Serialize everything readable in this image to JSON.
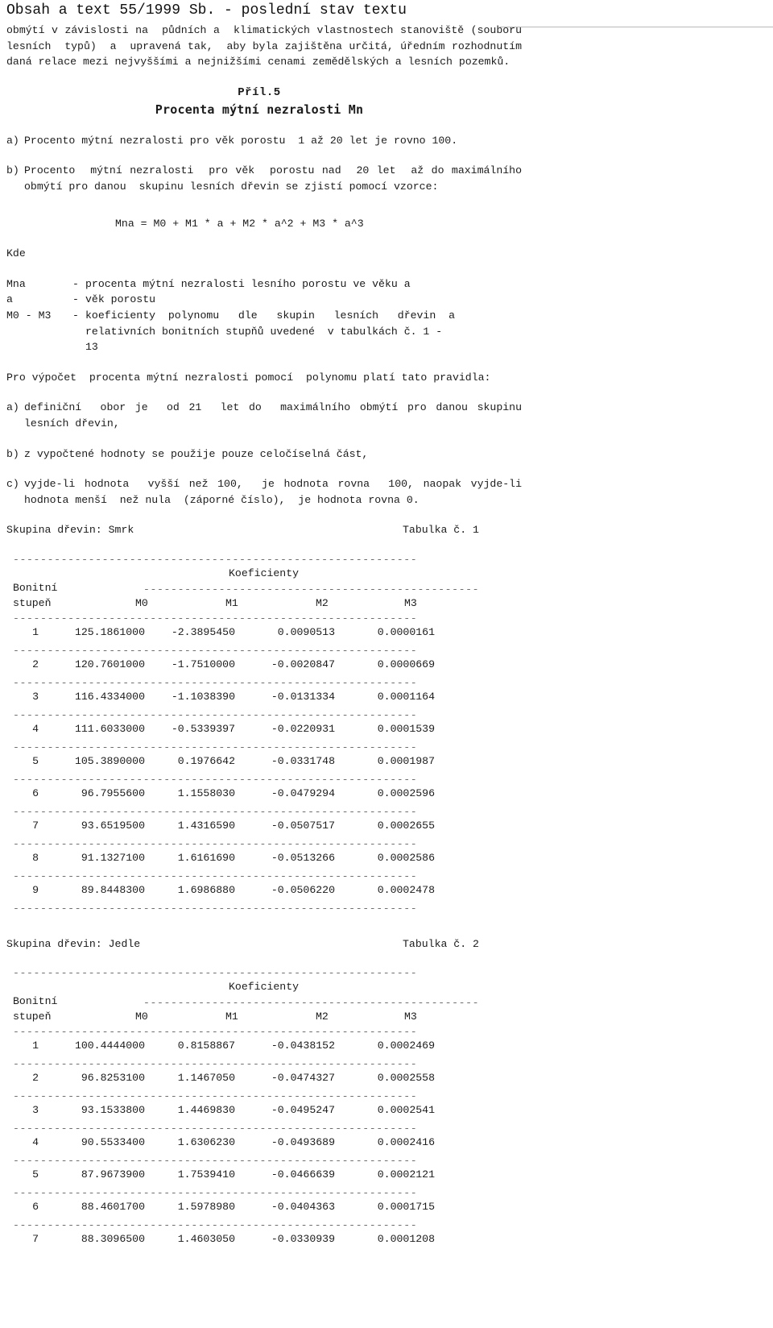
{
  "header": {
    "title": "Obsah a text 55/1999 Sb. - poslední stav textu"
  },
  "intro": {
    "paragraph": "obmýtí v závislosti na  půdních a  klimatických vlastnostech stanoviště (souboru  lesních  typů)  a  upravená tak,  aby byla zajištěna určitá, úředním rozhodnutím  daná relace mezi nejvyššími a nejnižšími cenami zemědělských a lesních pozemků."
  },
  "appendix": {
    "number_label": "Příl.5",
    "title": "Procenta mýtní nezralosti Mn"
  },
  "rules_top": [
    {
      "marker": "a)",
      "text": "Procento mýtní nezralosti pro věk porostu  1 až 20 let je rovno 100."
    },
    {
      "marker": "b)",
      "text": "Procento  mýtní nezralosti  pro věk  porostu nad  20 let  až do maximálního  obmýtí pro danou  skupinu lesních dřevin se zjistí pomocí vzorce:"
    }
  ],
  "formula": "Mna = M0 + M1 * a + M2 * a^2 + M3 * a^3",
  "where": {
    "label": "Kde",
    "definitions": [
      {
        "term": "Mna",
        "dash": "-",
        "desc": "procenta mýtní nezralosti lesního porostu ve věku a"
      },
      {
        "term": "a",
        "dash": "-",
        "desc": "věk porostu"
      },
      {
        "term": "M0 - M3",
        "dash": "-",
        "desc": "koeficienty  polynomu   dle   skupin   lesních   dřevin  a"
      }
    ],
    "cont_line_1": "relativních bonitních stupňů uvedené  v tabulkách č. 1 -",
    "cont_line_2": "13"
  },
  "calc_intro": "Pro výpočet  procenta mýtní nezralosti pomocí  polynomu platí tato pravidla:",
  "rules_calc": [
    {
      "marker": "a)",
      "text": "definiční  obor je  od 21  let do  maximálního obmýtí pro danou skupinu lesních dřevin,"
    },
    {
      "marker": "b)",
      "text": "z vypočtené hodnoty se použije pouze celočíselná část,"
    },
    {
      "marker": "c)",
      "text": "vyjde-li hodnota  vyšší než 100,  je hodnota rovna  100, naopak vyjde-li  hodnota menší  než nula  (záporné číslo),  je hodnota rovna 0."
    }
  ],
  "table_common": {
    "koeficienty_label": "Koeficienty",
    "bonitni_label": "Bonitní",
    "stupen_label": "stupeň",
    "columns": [
      "M0",
      "M1",
      "M2",
      "M3"
    ],
    "full_rule": "-----------------------------------------------------------",
    "short_rule": "-------------------------------------------------"
  },
  "tables": [
    {
      "group_label": "Skupina dřevin: Smrk",
      "table_label": "Tabulka č. 1",
      "rows": [
        {
          "stupen": "1",
          "m0": "125.1861000",
          "m1": "-2.3895450",
          "m2": "0.0090513",
          "m3": "0.0000161"
        },
        {
          "stupen": "2",
          "m0": "120.7601000",
          "m1": "-1.7510000",
          "m2": "-0.0020847",
          "m3": "0.0000669"
        },
        {
          "stupen": "3",
          "m0": "116.4334000",
          "m1": "-1.1038390",
          "m2": "-0.0131334",
          "m3": "0.0001164"
        },
        {
          "stupen": "4",
          "m0": "111.6033000",
          "m1": "-0.5339397",
          "m2": "-0.0220931",
          "m3": "0.0001539"
        },
        {
          "stupen": "5",
          "m0": "105.3890000",
          "m1": "0.1976642",
          "m2": "-0.0331748",
          "m3": "0.0001987"
        },
        {
          "stupen": "6",
          "m0": "96.7955600",
          "m1": "1.1558030",
          "m2": "-0.0479294",
          "m3": "0.0002596"
        },
        {
          "stupen": "7",
          "m0": "93.6519500",
          "m1": "1.4316590",
          "m2": "-0.0507517",
          "m3": "0.0002655"
        },
        {
          "stupen": "8",
          "m0": "91.1327100",
          "m1": "1.6161690",
          "m2": "-0.0513266",
          "m3": "0.0002586"
        },
        {
          "stupen": "9",
          "m0": "89.8448300",
          "m1": "1.6986880",
          "m2": "-0.0506220",
          "m3": "0.0002478"
        }
      ]
    },
    {
      "group_label": "Skupina dřevin: Jedle",
      "table_label": "Tabulka č. 2",
      "rows": [
        {
          "stupen": "1",
          "m0": "100.4444000",
          "m1": "0.8158867",
          "m2": "-0.0438152",
          "m3": "0.0002469"
        },
        {
          "stupen": "2",
          "m0": "96.8253100",
          "m1": "1.1467050",
          "m2": "-0.0474327",
          "m3": "0.0002558"
        },
        {
          "stupen": "3",
          "m0": "93.1533800",
          "m1": "1.4469830",
          "m2": "-0.0495247",
          "m3": "0.0002541"
        },
        {
          "stupen": "4",
          "m0": "90.5533400",
          "m1": "1.6306230",
          "m2": "-0.0493689",
          "m3": "0.0002416"
        },
        {
          "stupen": "5",
          "m0": "87.9673900",
          "m1": "1.7539410",
          "m2": "-0.0466639",
          "m3": "0.0002121"
        },
        {
          "stupen": "6",
          "m0": "88.4601700",
          "m1": "1.5978980",
          "m2": "-0.0404363",
          "m3": "0.0001715"
        },
        {
          "stupen": "7",
          "m0": "88.3096500",
          "m1": "1.4603050",
          "m2": "-0.0330939",
          "m3": "0.0001208"
        }
      ]
    }
  ],
  "colors": {
    "text": "#1c1c1c",
    "rule": "#b9b9b9",
    "dash": "#6e6e6e"
  }
}
